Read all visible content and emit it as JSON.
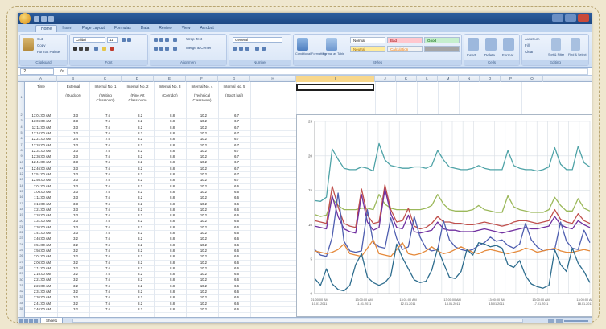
{
  "window": {
    "title": "",
    "tabs": [
      "Home",
      "Insert",
      "Page Layout",
      "Formulas",
      "Data",
      "Review",
      "View",
      "Acrobat"
    ],
    "active_tab": "Home"
  },
  "ribbon": {
    "groups": [
      {
        "label": "Clipboard",
        "items": [
          "Cut",
          "Copy",
          "Format Painter"
        ]
      },
      {
        "label": "Font",
        "items": [
          "Calibri",
          "11"
        ]
      },
      {
        "label": "Alignment",
        "items": [
          "Wrap Text",
          "Merge & Center"
        ]
      },
      {
        "label": "Number",
        "items": [
          "General"
        ]
      },
      {
        "label": "Styles",
        "items": [
          "Conditional Formatting",
          "Format as Table",
          "Normal",
          "Bad",
          "Good",
          "Neutral",
          "Calculation"
        ]
      },
      {
        "label": "Cells",
        "items": [
          "Insert",
          "Delete",
          "Format"
        ]
      },
      {
        "label": "Editing",
        "items": [
          "AutoSum",
          "Fill",
          "Clear",
          "Sort & Filter",
          "Find & Select"
        ]
      }
    ],
    "style_colors": {
      "normal": "#ffffff",
      "bad": "#ffc7ce",
      "good": "#c6efce",
      "neutral": "#ffeb9c",
      "calculation": "#f2f2f2",
      "check": "#a5a5a5"
    }
  },
  "formula_bar": {
    "name_box": "I2",
    "fx": "fx",
    "value": ""
  },
  "columns": [
    "A",
    "B",
    "C",
    "D",
    "E",
    "F",
    "G",
    "H",
    "I",
    "J",
    "K",
    "L",
    "M",
    "N",
    "O",
    "P",
    "Q"
  ],
  "selected_column": "I",
  "table": {
    "headers_row1": [
      "Time",
      "External",
      "Internal No. 1",
      "Internal No. 2",
      "Internal No. 3",
      "Internal No. 4",
      "Internal No. 5"
    ],
    "headers_row2": [
      "",
      "(Outdoor)",
      "(Writing Classroom)",
      "(Fine Art Classroom)",
      "(Corridor)",
      "(Technical Classroom)",
      "(Sport hall)"
    ],
    "rows": [
      [
        "13:01:00 AM",
        "3.3",
        "7.6",
        "8.2",
        "8.8",
        "10.2",
        "6.7"
      ],
      [
        "13:06:00 AM",
        "3.3",
        "7.6",
        "8.2",
        "8.8",
        "10.2",
        "6.7"
      ],
      [
        "12:11:00 AM",
        "3.3",
        "7.6",
        "8.2",
        "8.8",
        "10.2",
        "6.7"
      ],
      [
        "12:16:00 AM",
        "3.3",
        "7.6",
        "8.2",
        "8.8",
        "10.2",
        "6.7"
      ],
      [
        "12:21:00 AM",
        "3.4",
        "7.6",
        "8.2",
        "8.8",
        "10.2",
        "6.7"
      ],
      [
        "12:26:00 AM",
        "3.3",
        "7.6",
        "8.2",
        "8.8",
        "10.2",
        "6.7"
      ],
      [
        "12:31:00 AM",
        "3.3",
        "7.6",
        "8.2",
        "8.8",
        "10.2",
        "6.7"
      ],
      [
        "12:36:00 AM",
        "3.3",
        "7.6",
        "8.2",
        "8.8",
        "10.2",
        "6.7"
      ],
      [
        "12:41:00 AM",
        "3.3",
        "7.6",
        "8.2",
        "8.8",
        "10.2",
        "6.7"
      ],
      [
        "12:46:00 AM",
        "3.3",
        "7.6",
        "8.2",
        "8.8",
        "10.2",
        "6.7"
      ],
      [
        "12:51:00 AM",
        "3.3",
        "7.6",
        "8.2",
        "8.8",
        "10.2",
        "6.7"
      ],
      [
        "12:56:00 AM",
        "3.3",
        "7.6",
        "8.2",
        "8.8",
        "10.2",
        "6.7"
      ],
      [
        "1:01:00 AM",
        "3.3",
        "7.6",
        "8.2",
        "8.8",
        "10.2",
        "6.6"
      ],
      [
        "1:06:00 AM",
        "3.3",
        "7.6",
        "8.2",
        "8.8",
        "10.2",
        "6.6"
      ],
      [
        "1:11:00 AM",
        "3.3",
        "7.6",
        "8.2",
        "8.8",
        "10.2",
        "6.6"
      ],
      [
        "1:16:00 AM",
        "3.3",
        "7.6",
        "8.2",
        "8.8",
        "10.2",
        "6.6"
      ],
      [
        "1:21:00 AM",
        "3.3",
        "7.6",
        "8.2",
        "8.8",
        "10.2",
        "6.6"
      ],
      [
        "1:26:00 AM",
        "3.3",
        "7.6",
        "8.2",
        "8.8",
        "10.2",
        "6.6"
      ],
      [
        "1:31:00 AM",
        "3.3",
        "7.6",
        "8.2",
        "8.8",
        "10.2",
        "6.6"
      ],
      [
        "1:36:00 AM",
        "3.3",
        "7.6",
        "8.2",
        "8.8",
        "10.2",
        "6.6"
      ],
      [
        "1:41:00 AM",
        "3.3",
        "7.6",
        "8.2",
        "8.8",
        "10.2",
        "6.6"
      ],
      [
        "1:46:00 AM",
        "3.2",
        "7.6",
        "8.2",
        "8.8",
        "10.2",
        "6.6"
      ],
      [
        "1:51:00 AM",
        "3.2",
        "7.6",
        "8.2",
        "8.8",
        "10.2",
        "6.6"
      ],
      [
        "1:56:00 AM",
        "3.2",
        "7.6",
        "8.2",
        "8.8",
        "10.2",
        "6.6"
      ],
      [
        "2:01:00 AM",
        "3.2",
        "7.6",
        "8.2",
        "8.8",
        "10.2",
        "6.6"
      ],
      [
        "2:06:00 AM",
        "3.2",
        "7.6",
        "8.2",
        "8.8",
        "10.2",
        "6.6"
      ],
      [
        "2:11:00 AM",
        "3.2",
        "7.6",
        "8.2",
        "8.8",
        "10.2",
        "6.6"
      ],
      [
        "2:16:00 AM",
        "3.2",
        "7.6",
        "8.2",
        "8.8",
        "10.2",
        "6.6"
      ],
      [
        "2:21:00 AM",
        "3.2",
        "7.6",
        "8.2",
        "8.8",
        "10.2",
        "6.6"
      ],
      [
        "2:26:00 AM",
        "3.2",
        "7.6",
        "8.2",
        "8.8",
        "10.2",
        "6.6"
      ],
      [
        "2:31:00 AM",
        "3.2",
        "7.6",
        "8.2",
        "8.8",
        "10.2",
        "6.6"
      ],
      [
        "2:36:00 AM",
        "3.2",
        "7.6",
        "8.2",
        "8.8",
        "10.2",
        "6.6"
      ],
      [
        "2:41:00 AM",
        "3.2",
        "7.6",
        "8.2",
        "8.8",
        "10.2",
        "6.6"
      ],
      [
        "2:46:00 AM",
        "3.2",
        "7.6",
        "8.2",
        "8.8",
        "10.2",
        "6.6"
      ]
    ]
  },
  "sheet_tabs": [
    "Sheet1"
  ],
  "chart_data": {
    "type": "line",
    "title": "",
    "xlabel": "",
    "ylabel": "",
    "ylim": [
      0,
      25
    ],
    "y_ticks": [
      "0",
      "5",
      "10",
      "15",
      "20",
      "25"
    ],
    "x_tick_labels": [
      "21:00:00 AM 10.01.2011",
      "13:00:00 AM 11.01.2011",
      "13:01:00 AM 12.01.2011",
      "13:00:00 AM 14.01.2011",
      "13:00:00 AM 15.01.2011",
      "13:00:00 AM 17.01.2011",
      "13:00:00 AM 18.01.2011"
    ],
    "x_count": 48,
    "grid": true,
    "series": [
      {
        "color": "#4fa3a7",
        "values": [
          13.5,
          13.4,
          14,
          21,
          19.5,
          18.2,
          18,
          18,
          18.4,
          18.2,
          17.8,
          21.8,
          19.4,
          18.6,
          18.4,
          18.2,
          18.2,
          18.4,
          18.4,
          18.2,
          18.6,
          20.8,
          19.4,
          18.4,
          18.2,
          18,
          18,
          18.2,
          18.6,
          18.2,
          18,
          18,
          18,
          20.8,
          18.6,
          18.2,
          18,
          18,
          17.8,
          18,
          18.4,
          21.2,
          18.8,
          18,
          18,
          21.4,
          19,
          18.4
        ]
      },
      {
        "color": "#9bb85a",
        "values": [
          11.5,
          11.2,
          11.4,
          13.8,
          12.8,
          12.2,
          12.2,
          12.2,
          12.4,
          12.4,
          12.2,
          14.4,
          13,
          12.4,
          12.2,
          12.2,
          12.2,
          12.2,
          12.2,
          12.4,
          12.8,
          14.4,
          13,
          12.2,
          12,
          12,
          12,
          12.2,
          12.8,
          12.2,
          12,
          11.8,
          11.8,
          14.2,
          12.6,
          12.2,
          12,
          11.8,
          11.8,
          11.8,
          12.2,
          14,
          12.8,
          12,
          12,
          13.8,
          12.4,
          12
        ]
      },
      {
        "color": "#c0504d",
        "values": [
          10.6,
          10.4,
          10.2,
          15.6,
          12.6,
          10.2,
          9.8,
          9.6,
          15.2,
          11.4,
          10.2,
          10.4,
          15.8,
          12.2,
          10.4,
          10.6,
          12.4,
          9.8,
          9.4,
          9.6,
          10.2,
          11.2,
          10.4,
          10.4,
          10.2,
          10.2,
          10,
          10,
          10.2,
          10.4,
          10.2,
          10,
          9.8,
          10,
          10.4,
          10.6,
          10.6,
          10.4,
          10.2,
          10.4,
          10.6,
          12.2,
          10.8,
          10.4,
          10.2,
          11.6,
          10.6,
          10.2
        ]
      },
      {
        "color": "#7030a0",
        "values": [
          9.8,
          9.6,
          9.4,
          14.2,
          11.2,
          9.4,
          9,
          8.8,
          14.4,
          10.4,
          9.2,
          9.6,
          15.2,
          11.6,
          9.6,
          9.4,
          11.4,
          9,
          8.8,
          9,
          9.2,
          10.4,
          9.4,
          9.2,
          9.2,
          9,
          9,
          9,
          9.2,
          9.4,
          9.2,
          9,
          8.8,
          9,
          9.2,
          9.4,
          9.6,
          9.4,
          9.4,
          9.6,
          9.8,
          11.2,
          10,
          9.6,
          9.4,
          10.6,
          10,
          9.6
        ]
      },
      {
        "color": "#4f5fb0",
        "values": [
          6.4,
          5.6,
          5.4,
          8.2,
          14.6,
          7.6,
          6.2,
          6,
          6.2,
          12.2,
          7.4,
          6.8,
          6.6,
          11,
          8,
          6.4,
          6.8,
          11.2,
          8.2,
          6.6,
          6.2,
          6.4,
          10.6,
          7.8,
          6.8,
          6.4,
          6.2,
          6.4,
          7,
          7.4,
          8.2,
          7.6,
          7.8,
          7,
          6.6,
          7.2,
          10.2,
          7.8,
          6.8,
          6.2,
          6.4,
          6.4,
          10.4,
          7.6,
          6.6,
          6.4,
          9.2,
          7.4
        ]
      },
      {
        "color": "#e58a3c",
        "values": [
          6.2,
          6,
          5.8,
          6,
          6.4,
          7.2,
          5.8,
          5.6,
          5.4,
          6.6,
          7.8,
          5.8,
          5.6,
          5.4,
          6.4,
          7.4,
          5.8,
          5.6,
          5.8,
          6.2,
          6.8,
          6.2,
          5.8,
          6,
          6.4,
          6.8,
          6.4,
          6,
          5.8,
          6.2,
          6.4,
          6.2,
          6,
          5.8,
          6,
          6.2,
          6.6,
          6.4,
          6,
          6.2,
          6.4,
          6.6,
          6.2,
          6,
          6,
          6.2,
          6.4,
          6.2
        ]
      },
      {
        "color": "#2e6d8e",
        "values": [
          2.2,
          1.2,
          3.6,
          1.4,
          0.6,
          0.4,
          1.2,
          4.2,
          5.8,
          2.4,
          1.6,
          1.2,
          1.6,
          2.6,
          7.2,
          5.2,
          3.6,
          2,
          1.6,
          1.8,
          3.4,
          6.6,
          4.4,
          2.4,
          2.2,
          3.2,
          6.4,
          5.6,
          7.4,
          7.2,
          6.8,
          7,
          6.6,
          4.2,
          3.8,
          4.8,
          2.6,
          1.4,
          1,
          0.8,
          1.2,
          6.4,
          4.2,
          3.2,
          6.6,
          4.4,
          3.2,
          1.6
        ]
      }
    ]
  }
}
